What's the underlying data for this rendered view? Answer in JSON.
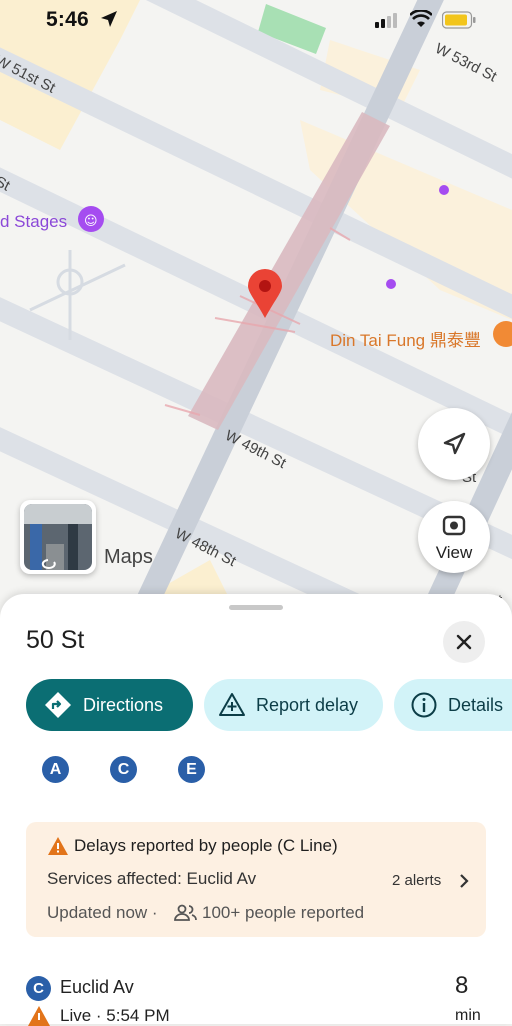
{
  "status_bar": {
    "time": "5:46"
  },
  "map": {
    "streets": [
      "W 53rd St",
      "W 51st St",
      "St",
      "W 49th St",
      "W 48th St",
      "St",
      "St"
    ],
    "places": {
      "stages": "d Stages",
      "restaurant": "Din Tai Fung 鼎泰豐"
    },
    "maps_label": "Maps",
    "view_button": "View",
    "colors": {
      "route": "#d9b9c0",
      "pin": "#ea4335",
      "street": "#c7cdd6"
    }
  },
  "sheet": {
    "title": "50 St",
    "actions": [
      {
        "label": "Directions",
        "icon": "directions-icon"
      },
      {
        "label": "Report delay",
        "icon": "report-delay-icon"
      },
      {
        "label": "Details",
        "icon": "info-icon"
      }
    ],
    "lines": [
      "A",
      "C",
      "E"
    ],
    "line_color": "#2a5fa8",
    "alert": {
      "title": "Delays reported by people (C Line)",
      "services": "Services affected: Euclid Av",
      "count": "2 alerts",
      "updated": "Updated now ·",
      "people": "100+ people reported"
    },
    "departure": {
      "line": "C",
      "stop": "Euclid Av",
      "live": "Live · 5:54 PM",
      "minutes": "8",
      "unit": "min"
    }
  }
}
